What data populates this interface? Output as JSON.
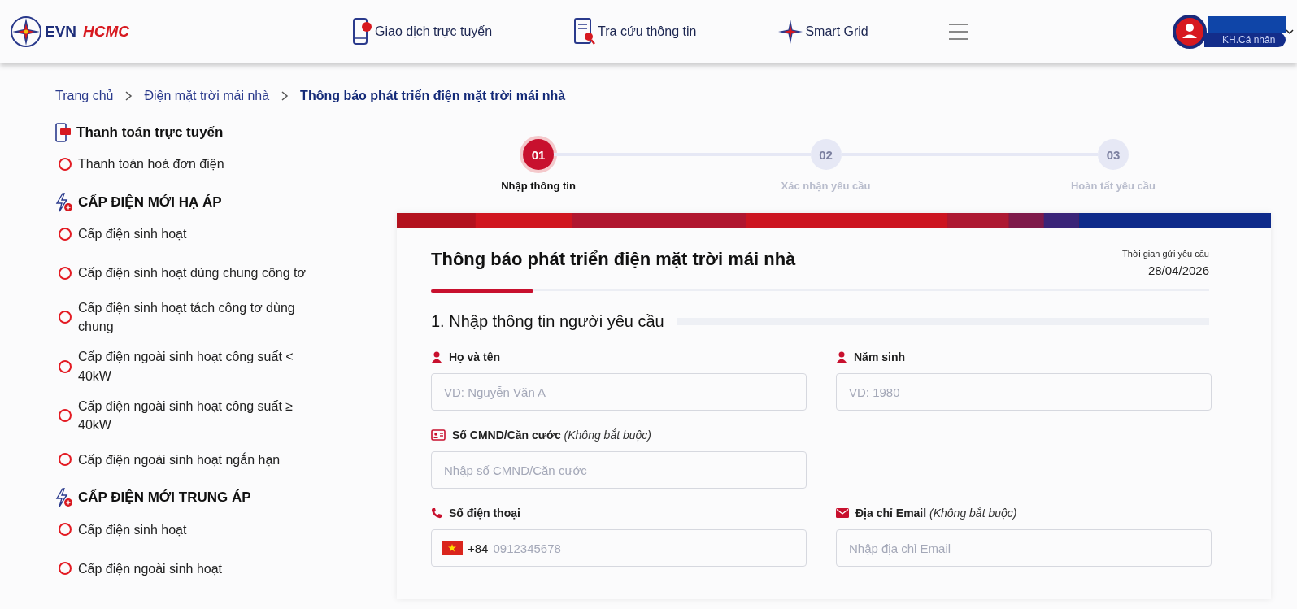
{
  "header": {
    "logo": {
      "part_1": "EVN",
      "part_2": "HCMC"
    },
    "nav": [
      {
        "label": "Giao dịch trực tuyến",
        "kind": "phone"
      },
      {
        "label": "Tra cứu thông tin",
        "kind": "doc"
      },
      {
        "label": "Smart Grid",
        "kind": "star"
      }
    ],
    "user": {
      "role": "KH.Cá nhân"
    }
  },
  "breadcrumb": [
    {
      "label": "Trang chủ",
      "selected": false
    },
    {
      "label": "Điện mặt trời mái nhà",
      "selected": false
    },
    {
      "label": "Thông báo phát triển điện mặt trời mái nhà",
      "selected": true
    }
  ],
  "sidebar": [
    {
      "title": "Thanh toán trực tuyến",
      "kind": "payment",
      "items": [
        {
          "label": "Thanh toán hoá đơn điện",
          "selected": false
        }
      ]
    },
    {
      "title": "CẤP ĐIỆN MỚI HẠ ÁP",
      "kind": "power",
      "items": [
        {
          "label": "Cấp điện sinh hoạt",
          "selected": false
        },
        {
          "label": "Cấp điện sinh hoạt dùng chung công tơ",
          "selected": false
        },
        {
          "label": "Cấp điện sinh hoạt tách công tơ dùng chung",
          "selected": false
        },
        {
          "label": "Cấp điện ngoài sinh hoạt công suất < 40kW",
          "selected": false
        },
        {
          "label": "Cấp điện ngoài sinh hoạt công suất ≥ 40kW",
          "selected": false
        },
        {
          "label": "Cấp điện ngoài sinh hoạt ngắn hạn",
          "selected": false
        }
      ]
    },
    {
      "title": "CẤP ĐIỆN MỚI TRUNG ÁP",
      "kind": "power",
      "items": [
        {
          "label": "Cấp điện sinh hoạt",
          "selected": false
        },
        {
          "label": "Cấp điện ngoài sinh hoạt",
          "selected": false
        }
      ]
    }
  ],
  "steps": [
    {
      "number": "01",
      "label": "Nhập thông tin",
      "selected": true
    },
    {
      "number": "02",
      "label": "Xác nhận yêu cầu",
      "selected": false
    },
    {
      "number": "03",
      "label": "Hoàn tất yêu cầu",
      "selected": false
    }
  ],
  "form": {
    "title": "Thông báo phát triển điện mặt trời mái nhà",
    "time_label": "Thời gian gửi yêu cầu",
    "time_value": "28/04/2026",
    "section": "1. Nhập thông tin người yêu cầu",
    "fields": [
      {
        "label": "Họ và tên",
        "kind": "person",
        "placeholder": "VD: Nguyễn Văn A"
      },
      {
        "label": "Năm sinh",
        "kind": "person",
        "placeholder": "VD: 1980"
      },
      {
        "label": "Số CMND/Căn cước",
        "note": "(Không bắt buộc)",
        "kind": "id",
        "placeholder": "Nhập số CMND/Căn cước"
      },
      {
        "label": "Số điện thoại",
        "kind": "phone",
        "prefix": "+84",
        "placeholder": "0912345678"
      },
      {
        "label": "Địa chỉ Email",
        "note": "(Không bắt buộc)",
        "kind": "mail",
        "placeholder": "Nhập địa chỉ Email"
      }
    ]
  }
}
